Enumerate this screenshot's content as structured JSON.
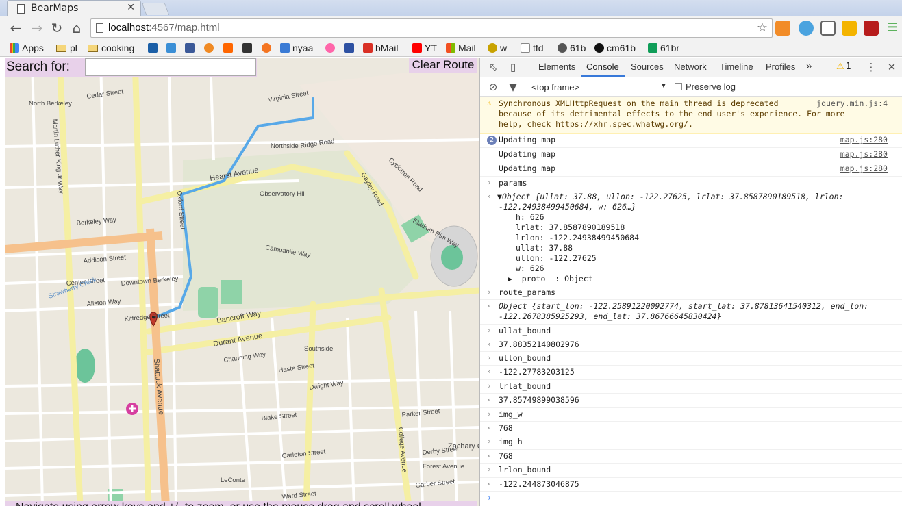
{
  "browser": {
    "tab_title": "BearMaps",
    "tab_close": "✕",
    "url_host": "localhost",
    "url_rest": ":4567/map.html"
  },
  "bookmarks": [
    {
      "label": "Apps",
      "icon": "apps-grid-icon",
      "color": "#e94235"
    },
    {
      "label": "pl",
      "icon": "folder-icon"
    },
    {
      "label": "cooking",
      "icon": "folder-icon"
    },
    {
      "label": "",
      "icon": "p-icon",
      "color": "#1b5fa7"
    },
    {
      "label": "",
      "icon": "p-icon",
      "color": "#3b8fd6"
    },
    {
      "label": "",
      "icon": "facebook-icon",
      "color": "#3b5998"
    },
    {
      "label": "",
      "icon": "c-icon",
      "color": "#f08a24"
    },
    {
      "label": "",
      "icon": "y-icon",
      "color": "#ff6600"
    },
    {
      "label": "",
      "icon": "tl-icon",
      "color": "#333333"
    },
    {
      "label": "",
      "icon": "crunchy-icon",
      "color": "#f47521"
    },
    {
      "label": "nyaa",
      "icon": "nyaa-icon",
      "color": "#3a7bd5"
    },
    {
      "label": "",
      "icon": "osu-icon",
      "color": "#ff66aa"
    },
    {
      "label": "",
      "icon": "mal-icon",
      "color": "#2e51a2"
    },
    {
      "label": "bMail",
      "icon": "gmail-icon",
      "color": "#d93025"
    },
    {
      "label": "YT",
      "icon": "youtube-icon",
      "color": "#ff0000"
    },
    {
      "label": "Mail",
      "icon": "outlook-icon",
      "color": "#0078d4"
    },
    {
      "label": "w",
      "icon": "w-icon",
      "color": "#c8a200"
    },
    {
      "label": "tfd",
      "icon": "page-icon",
      "color": "#888888"
    },
    {
      "label": "61b",
      "icon": "bear-icon",
      "color": "#555555"
    },
    {
      "label": "cm61b",
      "icon": "github-icon",
      "color": "#111111"
    },
    {
      "label": "61br",
      "icon": "sheets-icon",
      "color": "#0f9d58"
    }
  ],
  "map": {
    "search_label": "Search for:",
    "search_value": "",
    "clear_route": "Clear Route",
    "nav_hint": "Navigate using arrow keys and +/- to zoom, or use the mouse drag and scroll wheel",
    "street_labels": [
      "North Berkeley",
      "Cedar Street",
      "Hearst Avenue",
      "Virginia Street",
      "Northside",
      "Ridge Road",
      "Observatory Hill",
      "Campanile Way",
      "Stadium Rim Way",
      "Gayley Road",
      "Cyclotron Road",
      "Berkeley Way",
      "Addison Street",
      "Center Street",
      "Downtown Berkeley",
      "Allston Way",
      "Kittredge Street",
      "Bancroft Way",
      "Durant Avenue",
      "Channing Way",
      "Haste Street",
      "Dwight Way",
      "Blake Street",
      "Parker Street",
      "Derby Street",
      "Carleton Street",
      "Ward Street",
      "LeConte",
      "Zachary Corner",
      "Southside",
      "Strawberry Creek",
      "Shattuck Avenue",
      "Martin Luther King Jr Way",
      "Oxford Street",
      "College Avenue",
      "Forest Avenue",
      "Garber Street"
    ]
  },
  "devtools": {
    "tabs": [
      "Elements",
      "Console",
      "Sources",
      "Network",
      "Timeline",
      "Profiles"
    ],
    "active_tab": "Console",
    "more": "»",
    "warning_count": "1",
    "frame": "<top frame>",
    "preserve_log": "Preserve log",
    "console": {
      "warning_text": "Synchronous XMLHttpRequest on the main thread is deprecated\nbecause of its detrimental effects to the end user's experience. For more\nhelp, check https://xhr.spec.whatwg.org/.",
      "warning_src": "jquery.min.js:4",
      "update_count": "2",
      "update_text": "Updating map",
      "update_src": "map.js:280",
      "params_cmd": "params",
      "params_obj_line1": "Object {ullat: 37.88, ullon: -122.27625, lrlat: 37.8587890189518, lrlon:",
      "params_obj_line2": "-122.24938499450684, w: 626…}",
      "params_h": "h: 626",
      "params_lrlat": "lrlat: 37.8587890189518",
      "params_lrlon": "lrlon: -122.24938499450684",
      "params_ullat": "ullat: 37.88",
      "params_ullon": "ullon: -122.27625",
      "params_w": "w: 626",
      "params_proto": "proto  : Object",
      "route_cmd": "route_params",
      "route_line1": "Object {start_lon: -122.25891220092774, start_lat: 37.87813641540312, end_lon:",
      "route_line2": "-122.2678385925293, end_lat: 37.86766645830424}",
      "ullat_cmd": "ullat_bound",
      "ullat_val": "37.88352140802976",
      "ullon_cmd": "ullon_bound",
      "ullon_val": "-122.27783203125",
      "lrlat_cmd": "lrlat_bound",
      "lrlat_val": "37.85749899038596",
      "imgw_cmd": "img_w",
      "imgw_val": "768",
      "imgh_cmd": "img_h",
      "imgh_val": "768",
      "lrlon_cmd": "lrlon_bound",
      "lrlon_val": "-122.244873046875"
    }
  }
}
